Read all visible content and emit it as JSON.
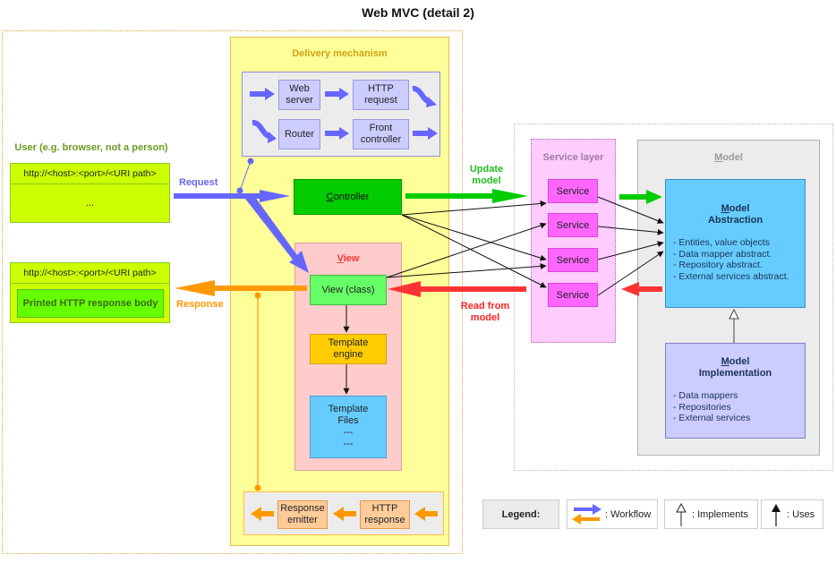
{
  "title": "Web MVC (detail 2)",
  "colors": {
    "workflow_request": "#6666ff",
    "workflow_response": "#ff9900",
    "update_model": "#00cc00",
    "read_from_model": "#ff3333",
    "delivery_bg": "#ffff99",
    "controller_bg": "#00cc00",
    "view_bg": "#ffcccc",
    "service_layer_bg": "#ffccff",
    "service_bg": "#ff66ff",
    "model_abstraction_bg": "#66ccff",
    "model_implementation_bg": "#ccccff"
  },
  "user": {
    "label": "User (e.g. browser, not a person)",
    "request_url": "http://<host>:<port>/<URI path>",
    "request_body": "...",
    "response_url": "http://<host>:<port>/<URI path>",
    "response_body": "Printed HTTP response body"
  },
  "flows": {
    "request": "Request",
    "response": "Response",
    "update_model": [
      "Update",
      "model"
    ],
    "read_from_model": [
      "Read from",
      "model"
    ]
  },
  "delivery": {
    "title": "Delivery mechanism",
    "request_chain": [
      {
        "lines": [
          "Web",
          "server"
        ]
      },
      {
        "lines": [
          "HTTP",
          "request"
        ]
      },
      {
        "lines": [
          "Router"
        ]
      },
      {
        "lines": [
          "Front",
          "controller"
        ]
      }
    ],
    "response_chain": [
      {
        "lines": [
          "Response",
          "emitter"
        ]
      },
      {
        "lines": [
          "HTTP",
          "response"
        ]
      }
    ]
  },
  "controller": {
    "first_letter": "C",
    "rest": "ontroller"
  },
  "view": {
    "title_first_letter": "V",
    "title_rest": "iew",
    "class_label": "View (class)",
    "template_engine": [
      "Template",
      "engine"
    ],
    "template_files": [
      "Template",
      "Files",
      "---",
      "---"
    ]
  },
  "service_layer": {
    "title": "Service layer",
    "services": [
      "Service",
      "Service",
      "Service",
      "Service"
    ]
  },
  "model": {
    "title_first_letter": "M",
    "title_rest": "odel",
    "abstraction": {
      "title_first_letter": "M",
      "title_rest": "odel",
      "subtitle": "Abstraction",
      "items": [
        "- Entities, value objects",
        "- Data mapper abstract.",
        "- Repository abstract.",
        "- External services abstract."
      ]
    },
    "implementation": {
      "title_first_letter": "M",
      "title_rest": "odel",
      "subtitle": "Implementation",
      "items": [
        "- Data mappers",
        "- Repositories",
        "- External services"
      ]
    }
  },
  "legend": {
    "heading": "Legend:",
    "workflow": ": Workflow",
    "implements": ": Implements",
    "uses": ": Uses"
  }
}
